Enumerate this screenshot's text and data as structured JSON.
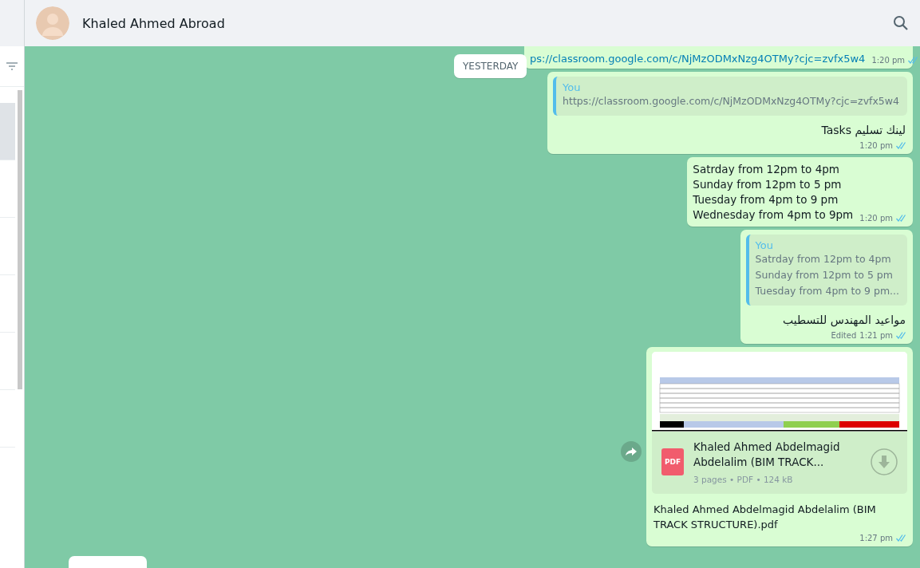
{
  "header": {
    "contact_name": "Khaled Ahmed Abroad"
  },
  "sidebar": {
    "items": [
      {
        "selected": true
      },
      {
        "selected": false
      },
      {
        "selected": false
      },
      {
        "selected": false
      },
      {
        "selected": false
      },
      {
        "selected": false
      }
    ]
  },
  "date_badge": "YESTERDAY",
  "messages": [
    {
      "kind": "link",
      "text": "ps://classroom.google.com/c/NjMzODMxNzg4OTMy?cjc=zvfx5w4",
      "time": "1:20 pm"
    },
    {
      "kind": "reply",
      "quote_author": "You",
      "quote_lines": [
        "https://classroom.google.com/c/NjMzODMxNzg4OTMy?cjc=zvfx5w4"
      ],
      "text": "لينك تسليم Tasks",
      "time": "1:20 pm"
    },
    {
      "kind": "text",
      "lines": [
        "Satrday from 12pm to 4pm",
        "Sunday from 12pm to 5 pm",
        "Tuesday from 4pm to 9 pm",
        "Wednesday from 4pm to 9pm"
      ],
      "time": "1:20 pm"
    },
    {
      "kind": "reply",
      "quote_author": "You",
      "quote_lines": [
        "Satrday from 12pm to 4pm",
        "Sunday from 12pm to 5 pm",
        "Tuesday from 4pm to 9 pm..."
      ],
      "text": "مواعيد المهندس للتسطيب",
      "edited": "Edited",
      "time": "1:21 pm"
    },
    {
      "kind": "document",
      "file_name": "Khaled Ahmed Abdelmagid Abdelalim (BIM TRACK...",
      "file_type": "PDF",
      "meta": "3 pages • PDF • 124 kB",
      "caption": "Khaled Ahmed Abdelmagid Abdelalim (BIM TRACK STRUCTURE).pdf",
      "time": "1:27 pm"
    }
  ]
}
